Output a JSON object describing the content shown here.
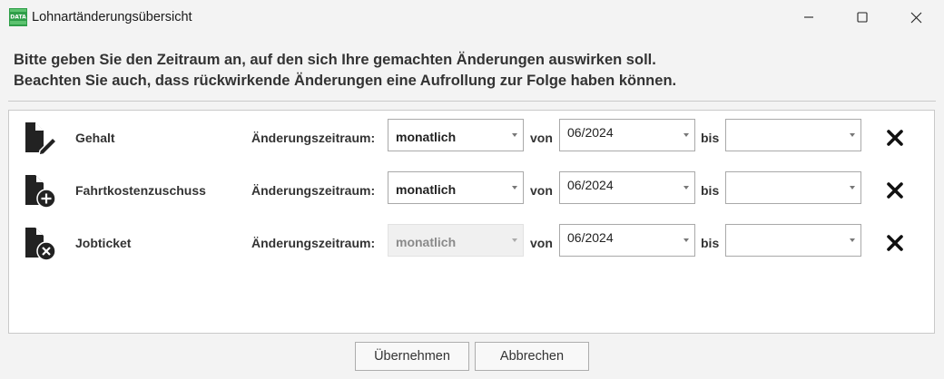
{
  "window": {
    "title": "Lohnartänderungsübersicht",
    "app_icon_text": "DATA",
    "accent_color": "#2e9e48"
  },
  "instructions": {
    "line1": "Bitte geben Sie den Zeitraum an, auf den sich Ihre gemachten Änderungen auswirken soll.",
    "line2": "Beachten Sie auch, dass rückwirkende Änderungen eine Aufrollung zur Folge haben können."
  },
  "labels": {
    "period": "Änderungszeitraum:",
    "from": "von",
    "to": "bis"
  },
  "rows": [
    {
      "name": "Gehalt",
      "icon": "document-edit-icon",
      "period": "monatlich",
      "period_disabled": false,
      "from": "06/2024",
      "to": ""
    },
    {
      "name": "Fahrtkostenzuschuss",
      "icon": "document-add-icon",
      "period": "monatlich",
      "period_disabled": false,
      "from": "06/2024",
      "to": ""
    },
    {
      "name": "Jobticket",
      "icon": "document-remove-icon",
      "period": "monatlich",
      "period_disabled": true,
      "from": "06/2024",
      "to": ""
    }
  ],
  "buttons": {
    "apply": "Übernehmen",
    "cancel": "Abbrechen"
  }
}
